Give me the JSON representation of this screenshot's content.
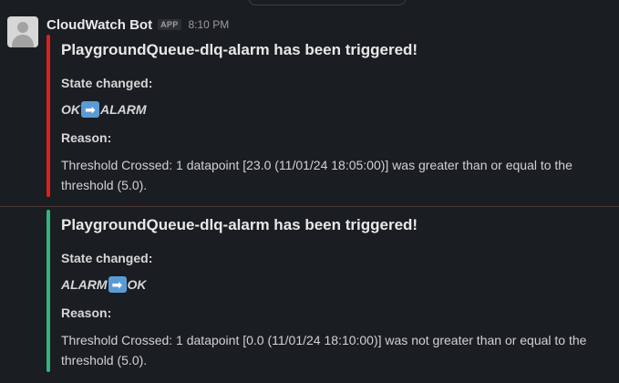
{
  "message": {
    "bot_name": "CloudWatch Bot",
    "app_badge": "APP",
    "timestamp": "8:10 PM",
    "avatar_icon": "default-user-avatar-icon"
  },
  "attachments": [
    {
      "bar_color": "#e01e1e",
      "title": "PlaygroundQueue-dlq-alarm has been triggered!",
      "state_label": "State changed:",
      "state_from": "OK",
      "state_arrow": "➡",
      "state_to": "ALARM",
      "reason_label": "Reason:",
      "reason_text": "Threshold Crossed: 1 datapoint [23.0 (11/01/24 18:05:00)] was greater than or equal to the threshold (5.0)."
    },
    {
      "bar_color": "#2eb67d",
      "title": "PlaygroundQueue-dlq-alarm has been triggered!",
      "state_label": "State changed:",
      "state_from": "ALARM",
      "state_arrow": "➡",
      "state_to": "OK",
      "reason_label": "Reason:",
      "reason_text": "Threshold Crossed: 1 datapoint [0.0 (11/01/24 18:10:00)] was not greater than or equal to the threshold (5.0)."
    }
  ],
  "colors": {
    "background": "#1a1d21",
    "alarm_bar": "#e01e1e",
    "ok_bar": "#2eb67d",
    "arrow_emoji": "#5b9bd5"
  }
}
